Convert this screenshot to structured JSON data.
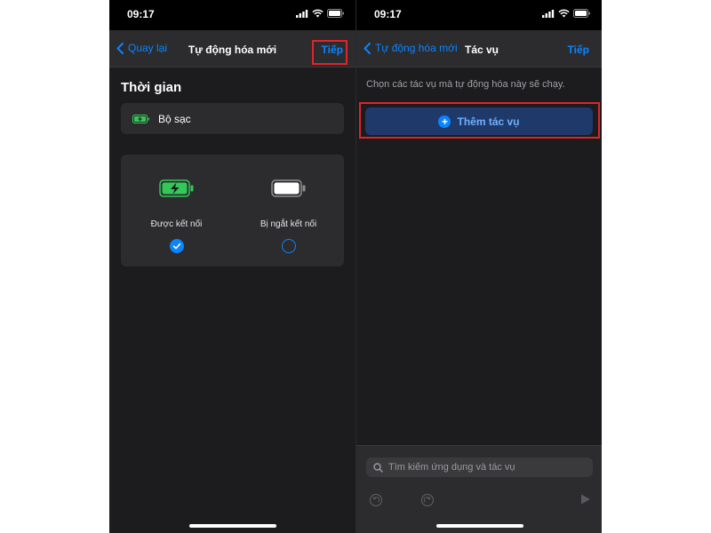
{
  "left_screen": {
    "status_time": "09:17",
    "nav": {
      "back_label": "Quay lại",
      "title": "Tự động hóa mới",
      "next_label": "Tiếp"
    },
    "section_title": "Thời gian",
    "trigger": {
      "label": "Bộ sạc",
      "icon": "battery-charging-icon"
    },
    "options": [
      {
        "label": "Được kết nối",
        "selected": true,
        "icon": "battery-charging-icon"
      },
      {
        "label": "Bị ngắt kết nối",
        "selected": false,
        "icon": "battery-full-icon"
      }
    ]
  },
  "right_screen": {
    "status_time": "09:17",
    "nav": {
      "back_label": "Tự động hóa mới",
      "title": "Tác vụ",
      "next_label": "Tiếp"
    },
    "hint": "Chọn các tác vụ mà tự động hóa này sẽ chạy.",
    "add_action_label": "Thêm tác vụ",
    "search": {
      "placeholder": "Tìm kiếm ứng dụng và tác vụ"
    },
    "toolbar_icons": [
      "undo-icon",
      "redo-icon",
      "play-icon"
    ]
  },
  "colors": {
    "accent": "#0a84ff",
    "background": "#1c1c1e",
    "card": "#2c2c2e",
    "highlight_box": "#e0242b",
    "battery_green": "#34c759"
  }
}
